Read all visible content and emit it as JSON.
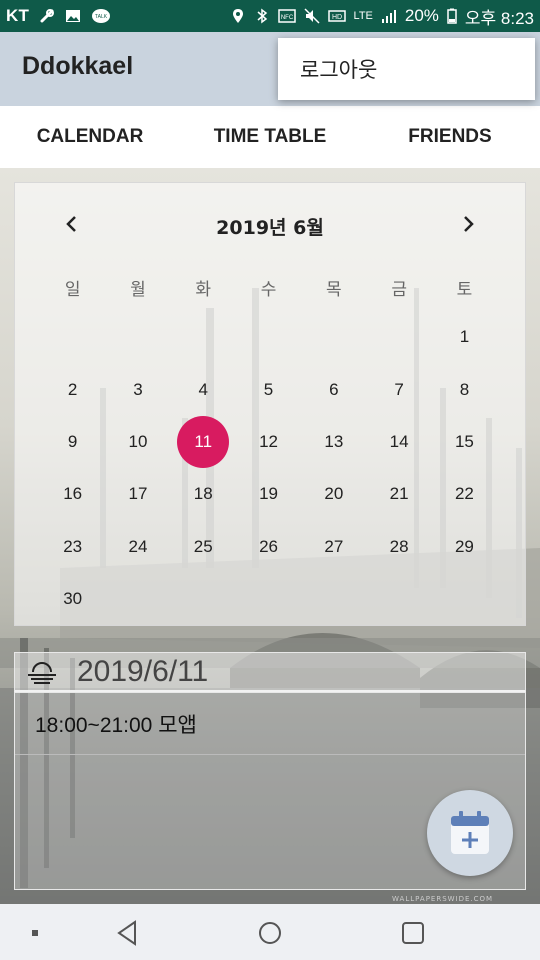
{
  "status_bar": {
    "carrier": "KT",
    "lte": "LTE",
    "battery": "20%",
    "time": "오후 8:23"
  },
  "app_bar": {
    "title": "Ddokkael",
    "menu_item": "로그아웃"
  },
  "tabs": [
    {
      "label": "CALENDAR"
    },
    {
      "label": "TIME TABLE"
    },
    {
      "label": "FRIENDS"
    }
  ],
  "calendar": {
    "title": "2019년 6월",
    "weekdays": [
      "일",
      "월",
      "화",
      "수",
      "목",
      "금",
      "토"
    ],
    "weeks": [
      [
        "",
        "",
        "",
        "",
        "",
        "",
        "1"
      ],
      [
        "2",
        "3",
        "4",
        "5",
        "6",
        "7",
        "8"
      ],
      [
        "9",
        "10",
        "11",
        "12",
        "13",
        "14",
        "15"
      ],
      [
        "16",
        "17",
        "18",
        "19",
        "20",
        "21",
        "22"
      ],
      [
        "23",
        "24",
        "25",
        "26",
        "27",
        "28",
        "29"
      ],
      [
        "30",
        "",
        "",
        "",
        "",
        "",
        ""
      ]
    ],
    "selected_day": "11",
    "selected_color": "#d81b60"
  },
  "detail": {
    "weather_icon": "fog-icon",
    "date": "2019/6/11",
    "events": [
      {
        "text": "18:00~21:00 모앱"
      }
    ]
  },
  "fab": {
    "icon": "calendar-add-icon"
  },
  "watermark": "WALLPAPERSWIDE.COM"
}
